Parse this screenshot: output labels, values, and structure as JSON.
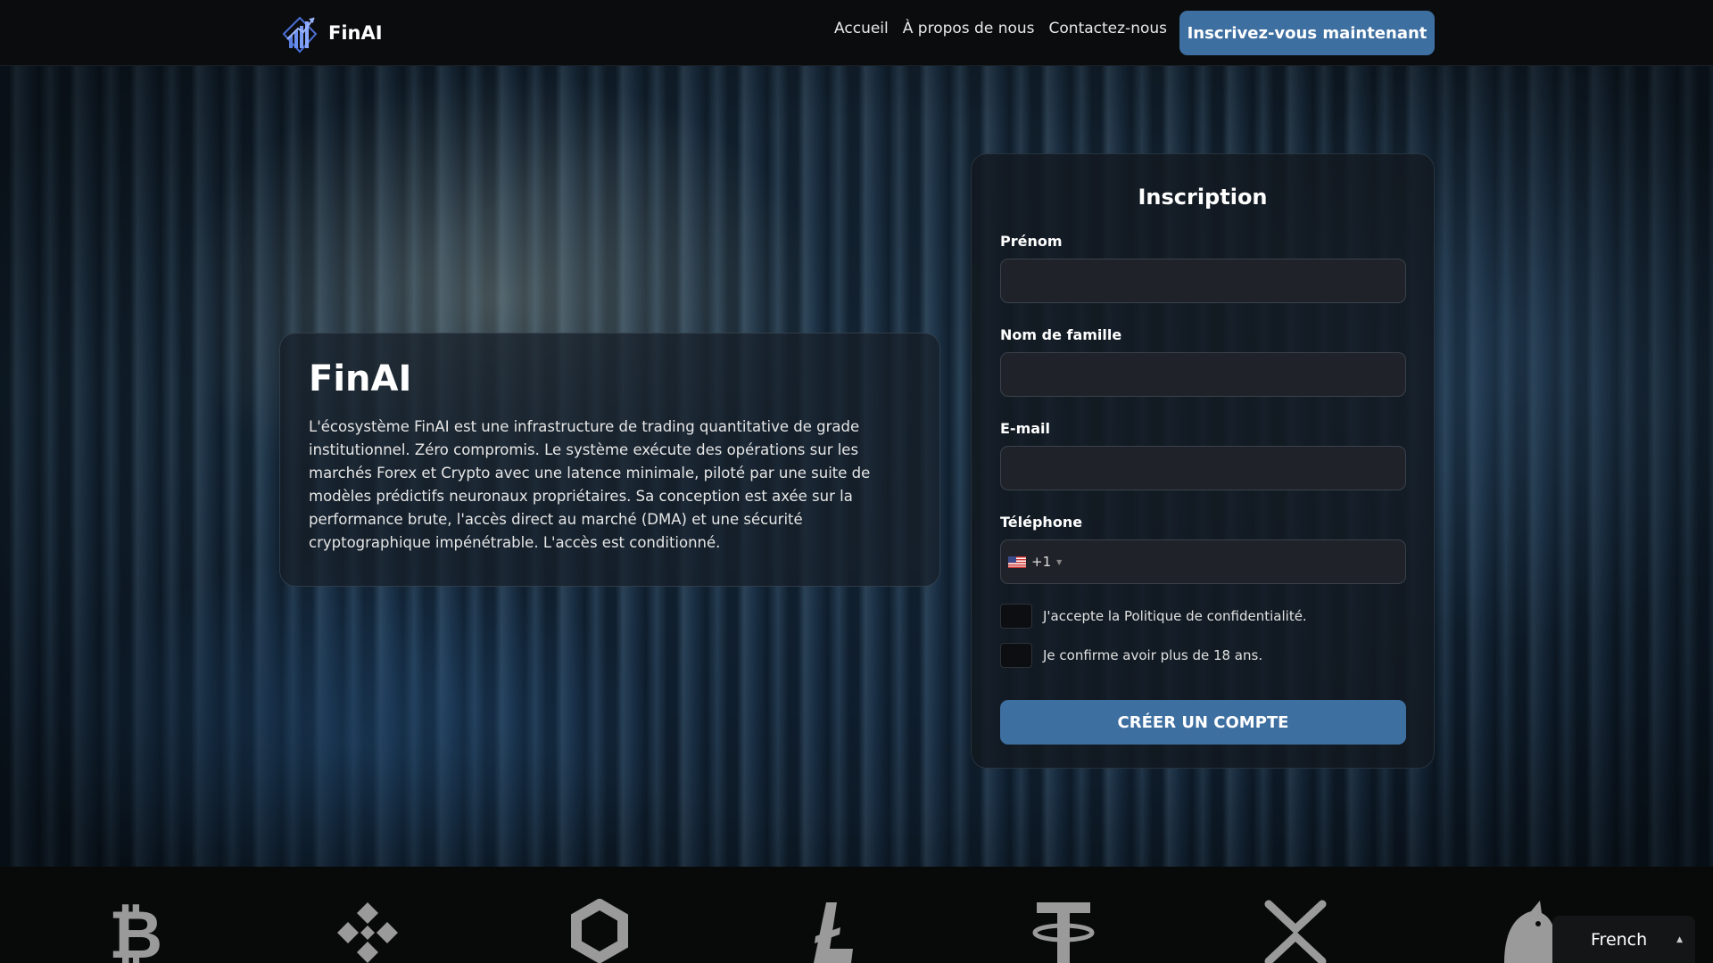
{
  "header": {
    "brand": "FinAI",
    "nav": [
      "Accueil",
      "À propos de nous",
      "Contactez-nous"
    ],
    "cta": "Inscrivez-vous maintenant"
  },
  "about": {
    "title": "FinAI",
    "text": "L'écosystème FinAI est une infrastructure de trading quantitative de grade institutionnel. Zéro compromis. Le système exécute des opérations sur les marchés Forex et Crypto avec une latence minimale, piloté par une suite de modèles prédictifs neuronaux propriétaires. Sa conception est axée sur la performance brute, l'accès direct au marché (DMA) et une sécurité cryptographique impénétrable. L'accès est conditionné."
  },
  "form": {
    "title": "Inscription",
    "first_name_label": "Prénom",
    "last_name_label": "Nom de famille",
    "email_label": "E-mail",
    "phone_label": "Téléphone",
    "dial_code": "+1",
    "privacy_label": "J'accepte la Politique de confidentialité.",
    "age_label": "Je confirme avoir plus de 18 ans.",
    "submit": "CRÉER UN COMPTE"
  },
  "ticker": {
    "coins": [
      "bitcoin-icon",
      "binance-icon",
      "chainlink-icon",
      "litecoin-icon",
      "tether-icon",
      "xrp-icon",
      "uniswap-icon"
    ]
  },
  "language": {
    "selected": "French"
  },
  "colors": {
    "accent": "#3e6fa1",
    "header_bg": "#0b0c0e",
    "field_bg": "#1f2329"
  }
}
